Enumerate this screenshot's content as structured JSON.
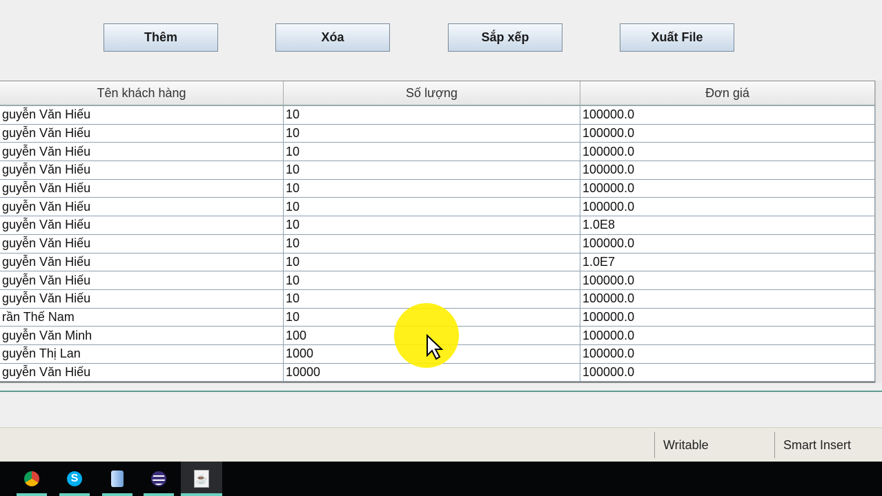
{
  "toolbar": {
    "add": "Thêm",
    "delete": "Xóa",
    "sort": "Sắp xếp",
    "export": "Xuất File"
  },
  "table": {
    "columns": [
      "Tên khách hàng",
      "Số lượng",
      "Đơn giá"
    ],
    "rows": [
      [
        "guyễn Văn Hiếu",
        "10",
        "100000.0"
      ],
      [
        "guyễn Văn Hiếu",
        "10",
        "100000.0"
      ],
      [
        "guyễn Văn Hiếu",
        "10",
        "100000.0"
      ],
      [
        "guyễn Văn Hiếu",
        "10",
        "100000.0"
      ],
      [
        "guyễn Văn Hiếu",
        "10",
        "100000.0"
      ],
      [
        "guyễn Văn Hiếu",
        "10",
        "100000.0"
      ],
      [
        "guyễn Văn Hiếu",
        "10",
        "1.0E8"
      ],
      [
        "guyễn Văn Hiếu",
        "10",
        "100000.0"
      ],
      [
        "guyễn Văn Hiếu",
        "10",
        "1.0E7"
      ],
      [
        "guyễn Văn Hiếu",
        "10",
        "100000.0"
      ],
      [
        "guyễn Văn Hiếu",
        "10",
        "100000.0"
      ],
      [
        "rần Thế Nam",
        "10",
        "100000.0"
      ],
      [
        "guyễn Văn Minh",
        "100",
        "100000.0"
      ],
      [
        "guyễn Thị Lan",
        "1000",
        "100000.0"
      ],
      [
        "guyễn Văn Hiếu",
        "10000",
        "100000.0"
      ]
    ]
  },
  "statusbar": {
    "mode": "Writable",
    "insert": "Smart Insert"
  },
  "taskbar": {
    "icons": [
      "chrome-icon",
      "skype-icon",
      "cube-app-icon",
      "eclipse-icon",
      "java-icon"
    ]
  }
}
